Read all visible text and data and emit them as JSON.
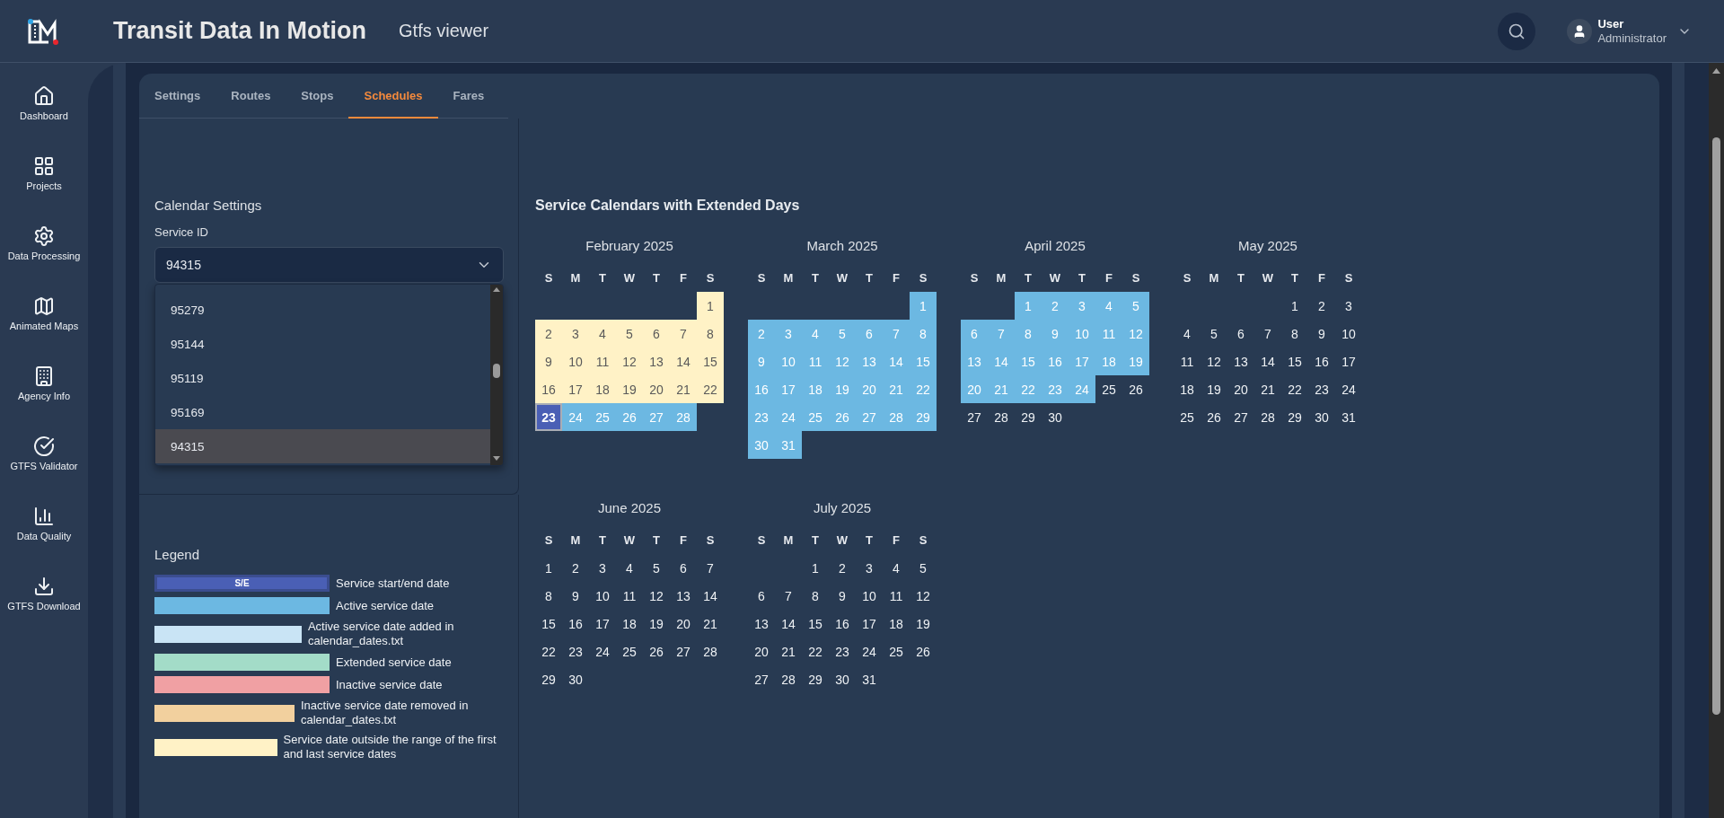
{
  "header": {
    "title": "Transit Data In Motion",
    "subtitle": "Gtfs viewer",
    "user": {
      "name": "User",
      "role": "Administrator"
    }
  },
  "sidebar": {
    "items": [
      {
        "label": "Dashboard"
      },
      {
        "label": "Projects"
      },
      {
        "label": "Data Processing"
      },
      {
        "label": "Animated Maps"
      },
      {
        "label": "Agency Info"
      },
      {
        "label": "GTFS Validator"
      },
      {
        "label": "Data Quality"
      },
      {
        "label": "GTFS Download"
      }
    ]
  },
  "tabs": [
    {
      "label": "Settings",
      "selected": false
    },
    {
      "label": "Routes",
      "selected": false
    },
    {
      "label": "Stops",
      "selected": false
    },
    {
      "label": "Schedules",
      "selected": true
    },
    {
      "label": "Fares",
      "selected": false
    }
  ],
  "calendar_settings": {
    "title": "Calendar Settings",
    "service_id": {
      "label": "Service ID",
      "value": "94315",
      "options": [
        {
          "label": "95279",
          "selected": false
        },
        {
          "label": "95144",
          "selected": false
        },
        {
          "label": "95119",
          "selected": false
        },
        {
          "label": "95169",
          "selected": false
        },
        {
          "label": "94315",
          "selected": true
        }
      ]
    }
  },
  "legend": {
    "title": "Legend",
    "items": [
      {
        "swatch": "S/E",
        "label": "Service start/end date",
        "color": "#4a5fb5"
      },
      {
        "label": "Active service date",
        "color": "#6cb8e2"
      },
      {
        "label": "Active service date added in calendar_dates.txt",
        "color": "#c9e4f5"
      },
      {
        "label": "Extended service date",
        "color": "#a3dcc8"
      },
      {
        "label": "Inactive service date",
        "color": "#f0a0a3"
      },
      {
        "label": "Inactive service date removed in calendar_dates.txt",
        "color": "#f2d09e"
      },
      {
        "label": "Service date outside the range of the first and last service dates",
        "color": "#fff2c6"
      }
    ]
  },
  "calendars": {
    "title": "Service Calendars with Extended Days",
    "months": [
      {
        "name": "February 2025",
        "weekdays": [
          "S",
          "M",
          "T",
          "W",
          "T",
          "F",
          "S"
        ],
        "weeks": [
          [
            {
              "day": "1",
              "kind": "outside"
            }
          ],
          [
            {
              "day": "2",
              "kind": "outside"
            },
            {
              "day": "3",
              "kind": "outside"
            },
            {
              "day": "4",
              "kind": "outside"
            },
            {
              "day": "5",
              "kind": "outside"
            },
            {
              "day": "6",
              "kind": "outside"
            },
            {
              "day": "7",
              "kind": "outside"
            },
            {
              "day": "8",
              "kind": "outside"
            }
          ],
          [
            {
              "day": "9",
              "kind": "outside"
            },
            {
              "day": "10",
              "kind": "outside"
            },
            {
              "day": "11",
              "kind": "outside"
            },
            {
              "day": "12",
              "kind": "outside"
            },
            {
              "day": "13",
              "kind": "outside"
            },
            {
              "day": "14",
              "kind": "outside"
            },
            {
              "day": "15",
              "kind": "outside"
            }
          ],
          [
            {
              "day": "16",
              "kind": "outside"
            },
            {
              "day": "17",
              "kind": "outside"
            },
            {
              "day": "18",
              "kind": "outside"
            },
            {
              "day": "19",
              "kind": "outside"
            },
            {
              "day": "20",
              "kind": "outside"
            },
            {
              "day": "21",
              "kind": "outside"
            },
            {
              "day": "22",
              "kind": "outside"
            }
          ],
          [
            {
              "day": "23",
              "kind": "start_end"
            },
            {
              "day": "24",
              "kind": "active"
            },
            {
              "day": "25",
              "kind": "active"
            },
            {
              "day": "26",
              "kind": "active"
            },
            {
              "day": "27",
              "kind": "active"
            },
            {
              "day": "28",
              "kind": "active"
            }
          ]
        ]
      },
      {
        "name": "March 2025",
        "weekdays": [
          "S",
          "M",
          "T",
          "W",
          "T",
          "F",
          "S"
        ],
        "weeks": [
          [
            {
              "day": "1",
              "kind": "active"
            }
          ],
          [
            {
              "day": "2",
              "kind": "active"
            },
            {
              "day": "3",
              "kind": "active"
            },
            {
              "day": "4",
              "kind": "active"
            },
            {
              "day": "5",
              "kind": "active"
            },
            {
              "day": "6",
              "kind": "active"
            },
            {
              "day": "7",
              "kind": "active"
            },
            {
              "day": "8",
              "kind": "active"
            }
          ],
          [
            {
              "day": "9",
              "kind": "active"
            },
            {
              "day": "10",
              "kind": "active"
            },
            {
              "day": "11",
              "kind": "active"
            },
            {
              "day": "12",
              "kind": "active"
            },
            {
              "day": "13",
              "kind": "active"
            },
            {
              "day": "14",
              "kind": "active"
            },
            {
              "day": "15",
              "kind": "active"
            }
          ],
          [
            {
              "day": "16",
              "kind": "active"
            },
            {
              "day": "17",
              "kind": "active"
            },
            {
              "day": "18",
              "kind": "active"
            },
            {
              "day": "19",
              "kind": "active"
            },
            {
              "day": "20",
              "kind": "active"
            },
            {
              "day": "21",
              "kind": "active"
            },
            {
              "day": "22",
              "kind": "active"
            }
          ],
          [
            {
              "day": "23",
              "kind": "active"
            },
            {
              "day": "24",
              "kind": "active"
            },
            {
              "day": "25",
              "kind": "active"
            },
            {
              "day": "26",
              "kind": "active"
            },
            {
              "day": "27",
              "kind": "active"
            },
            {
              "day": "28",
              "kind": "active"
            },
            {
              "day": "29",
              "kind": "active"
            }
          ],
          [
            {
              "day": "30",
              "kind": "active"
            },
            {
              "day": "31",
              "kind": "active"
            }
          ]
        ]
      },
      {
        "name": "April 2025",
        "weekdays": [
          "S",
          "M",
          "T",
          "W",
          "T",
          "F",
          "S"
        ],
        "weeks": [
          [
            {
              "day": "1",
              "kind": "active"
            },
            {
              "day": "2",
              "kind": "active"
            },
            {
              "day": "3",
              "kind": "active"
            },
            {
              "day": "4",
              "kind": "active"
            },
            {
              "day": "5",
              "kind": "active"
            }
          ],
          [
            {
              "day": "6",
              "kind": "active"
            },
            {
              "day": "7",
              "kind": "active"
            },
            {
              "day": "8",
              "kind": "active"
            },
            {
              "day": "9",
              "kind": "active"
            },
            {
              "day": "10",
              "kind": "active"
            },
            {
              "day": "11",
              "kind": "active"
            },
            {
              "day": "12",
              "kind": "active"
            }
          ],
          [
            {
              "day": "13",
              "kind": "active"
            },
            {
              "day": "14",
              "kind": "active"
            },
            {
              "day": "15",
              "kind": "active"
            },
            {
              "day": "16",
              "kind": "active"
            },
            {
              "day": "17",
              "kind": "active"
            },
            {
              "day": "18",
              "kind": "active"
            },
            {
              "day": "19",
              "kind": "active"
            }
          ],
          [
            {
              "day": "20",
              "kind": "active"
            },
            {
              "day": "21",
              "kind": "active"
            },
            {
              "day": "22",
              "kind": "active"
            },
            {
              "day": "23",
              "kind": "active"
            },
            {
              "day": "24",
              "kind": "active"
            },
            {
              "day": "25",
              "kind": "plain"
            },
            {
              "day": "26",
              "kind": "plain"
            }
          ],
          [
            {
              "day": "27",
              "kind": "plain"
            },
            {
              "day": "28",
              "kind": "plain"
            },
            {
              "day": "29",
              "kind": "plain"
            },
            {
              "day": "30",
              "kind": "plain"
            }
          ]
        ]
      },
      {
        "name": "May 2025",
        "weekdays": [
          "S",
          "M",
          "T",
          "W",
          "T",
          "F",
          "S"
        ],
        "weeks": [
          [
            {
              "day": "1",
              "kind": "plain"
            },
            {
              "day": "2",
              "kind": "plain"
            },
            {
              "day": "3",
              "kind": "plain"
            }
          ],
          [
            {
              "day": "4",
              "kind": "plain"
            },
            {
              "day": "5",
              "kind": "plain"
            },
            {
              "day": "6",
              "kind": "plain"
            },
            {
              "day": "7",
              "kind": "plain"
            },
            {
              "day": "8",
              "kind": "plain"
            },
            {
              "day": "9",
              "kind": "plain"
            },
            {
              "day": "10",
              "kind": "plain"
            }
          ],
          [
            {
              "day": "11",
              "kind": "plain"
            },
            {
              "day": "12",
              "kind": "plain"
            },
            {
              "day": "13",
              "kind": "plain"
            },
            {
              "day": "14",
              "kind": "plain"
            },
            {
              "day": "15",
              "kind": "plain"
            },
            {
              "day": "16",
              "kind": "plain"
            },
            {
              "day": "17",
              "kind": "plain"
            }
          ],
          [
            {
              "day": "18",
              "kind": "plain"
            },
            {
              "day": "19",
              "kind": "plain"
            },
            {
              "day": "20",
              "kind": "plain"
            },
            {
              "day": "21",
              "kind": "plain"
            },
            {
              "day": "22",
              "kind": "plain"
            },
            {
              "day": "23",
              "kind": "plain"
            },
            {
              "day": "24",
              "kind": "plain"
            }
          ],
          [
            {
              "day": "25",
              "kind": "plain"
            },
            {
              "day": "26",
              "kind": "plain"
            },
            {
              "day": "27",
              "kind": "plain"
            },
            {
              "day": "28",
              "kind": "plain"
            },
            {
              "day": "29",
              "kind": "plain"
            },
            {
              "day": "30",
              "kind": "plain"
            },
            {
              "day": "31",
              "kind": "plain"
            }
          ]
        ]
      },
      {
        "name": "June 2025",
        "weekdays": [
          "S",
          "M",
          "T",
          "W",
          "T",
          "F",
          "S"
        ],
        "weeks": [
          [
            {
              "day": "1",
              "kind": "plain"
            },
            {
              "day": "2",
              "kind": "plain"
            },
            {
              "day": "3",
              "kind": "plain"
            },
            {
              "day": "4",
              "kind": "plain"
            },
            {
              "day": "5",
              "kind": "plain"
            },
            {
              "day": "6",
              "kind": "plain"
            },
            {
              "day": "7",
              "kind": "plain"
            }
          ],
          [
            {
              "day": "8",
              "kind": "plain"
            },
            {
              "day": "9",
              "kind": "plain"
            },
            {
              "day": "10",
              "kind": "plain"
            },
            {
              "day": "11",
              "kind": "plain"
            },
            {
              "day": "12",
              "kind": "plain"
            },
            {
              "day": "13",
              "kind": "plain"
            },
            {
              "day": "14",
              "kind": "plain"
            }
          ],
          [
            {
              "day": "15",
              "kind": "plain"
            },
            {
              "day": "16",
              "kind": "plain"
            },
            {
              "day": "17",
              "kind": "plain"
            },
            {
              "day": "18",
              "kind": "plain"
            },
            {
              "day": "19",
              "kind": "plain"
            },
            {
              "day": "20",
              "kind": "plain"
            },
            {
              "day": "21",
              "kind": "plain"
            }
          ],
          [
            {
              "day": "22",
              "kind": "plain"
            },
            {
              "day": "23",
              "kind": "plain"
            },
            {
              "day": "24",
              "kind": "plain"
            },
            {
              "day": "25",
              "kind": "plain"
            },
            {
              "day": "26",
              "kind": "plain"
            },
            {
              "day": "27",
              "kind": "plain"
            },
            {
              "day": "28",
              "kind": "plain"
            }
          ],
          [
            {
              "day": "29",
              "kind": "plain"
            },
            {
              "day": "30",
              "kind": "plain"
            }
          ]
        ]
      },
      {
        "name": "July 2025",
        "weekdays": [
          "S",
          "M",
          "T",
          "W",
          "T",
          "F",
          "S"
        ],
        "weeks": [
          [
            {
              "day": "1",
              "kind": "plain"
            },
            {
              "day": "2",
              "kind": "plain"
            },
            {
              "day": "3",
              "kind": "plain"
            },
            {
              "day": "4",
              "kind": "plain"
            },
            {
              "day": "5",
              "kind": "plain"
            }
          ],
          [
            {
              "day": "6",
              "kind": "plain"
            },
            {
              "day": "7",
              "kind": "plain"
            },
            {
              "day": "8",
              "kind": "plain"
            },
            {
              "day": "9",
              "kind": "plain"
            },
            {
              "day": "10",
              "kind": "plain"
            },
            {
              "day": "11",
              "kind": "plain"
            },
            {
              "day": "12",
              "kind": "plain"
            }
          ],
          [
            {
              "day": "13",
              "kind": "plain"
            },
            {
              "day": "14",
              "kind": "plain"
            },
            {
              "day": "15",
              "kind": "plain"
            },
            {
              "day": "16",
              "kind": "plain"
            },
            {
              "day": "17",
              "kind": "plain"
            },
            {
              "day": "18",
              "kind": "plain"
            },
            {
              "day": "19",
              "kind": "plain"
            }
          ],
          [
            {
              "day": "20",
              "kind": "plain"
            },
            {
              "day": "21",
              "kind": "plain"
            },
            {
              "day": "22",
              "kind": "plain"
            },
            {
              "day": "23",
              "kind": "plain"
            },
            {
              "day": "24",
              "kind": "plain"
            },
            {
              "day": "25",
              "kind": "plain"
            },
            {
              "day": "26",
              "kind": "plain"
            }
          ],
          [
            {
              "day": "27",
              "kind": "plain"
            },
            {
              "day": "28",
              "kind": "plain"
            },
            {
              "day": "29",
              "kind": "plain"
            },
            {
              "day": "30",
              "kind": "plain"
            },
            {
              "day": "31",
              "kind": "plain"
            }
          ]
        ]
      }
    ]
  }
}
